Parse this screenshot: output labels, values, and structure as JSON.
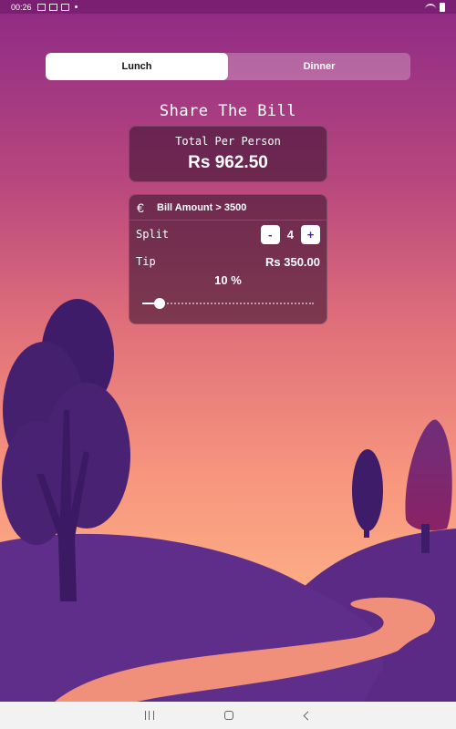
{
  "status_bar": {
    "time": "00:26"
  },
  "tabs": [
    {
      "label": "Lunch",
      "active": true
    },
    {
      "label": "Dinner",
      "active": false
    }
  ],
  "title": "Share The Bill",
  "total": {
    "label": "Total Per Person",
    "value": "Rs 962.50"
  },
  "bill": {
    "currency_icon": "euro-icon",
    "amount_label": "Bill Amount > 3500",
    "split": {
      "label": "Split",
      "count": "4",
      "minus": "-",
      "plus": "+"
    },
    "tip": {
      "label": "Tip",
      "amount": "Rs 350.00",
      "percent_text": "10 %",
      "slider_value": 0.1
    }
  },
  "colors": {
    "accent": "#4b2b9a",
    "card_bg": "#3c1432"
  }
}
